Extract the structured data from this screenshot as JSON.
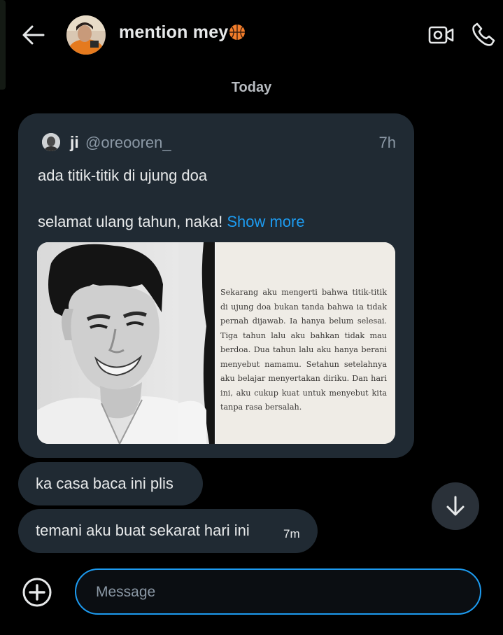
{
  "header": {
    "title": "mention mey",
    "title_emoji": "basketball-emoji",
    "back_icon": "arrow-left-icon",
    "video_icon": "video-camera-icon",
    "call_icon": "phone-icon"
  },
  "date_divider": "Today",
  "shared_post": {
    "name": "ji",
    "handle": "@oreooren_",
    "time": "7h",
    "line1": "ada titik-titik di ujung doa",
    "line2": "selamat ulang tahun, naka!",
    "show_more": "Show more",
    "page_text": "Sekarang aku mengerti bahwa titik-titik di ujung doa bukan tanda bahwa ia tidak pernah dijawab. Ia hanya belum selesai. Tiga tahun lalu aku bahkan tidak mau berdoa. Dua tahun lalu aku hanya berani menyebut namamu. Setahun setelahnya aku belajar menyertakan diriku. Dan hari ini, aku cukup kuat untuk menyebut kita tanpa rasa bersalah."
  },
  "messages": [
    {
      "text": "ka casa baca ini plis"
    },
    {
      "text": "temani aku buat sekarat hari ini",
      "time": "7m"
    }
  ],
  "composer": {
    "placeholder": "Message",
    "add_icon": "plus-circle-icon"
  },
  "scroll_down_icon": "arrow-down-icon",
  "colors": {
    "background": "#000000",
    "bubble": "#202a33",
    "accent": "#1d9bf0",
    "text": "#e7e9ea",
    "muted": "#8b98a5"
  }
}
